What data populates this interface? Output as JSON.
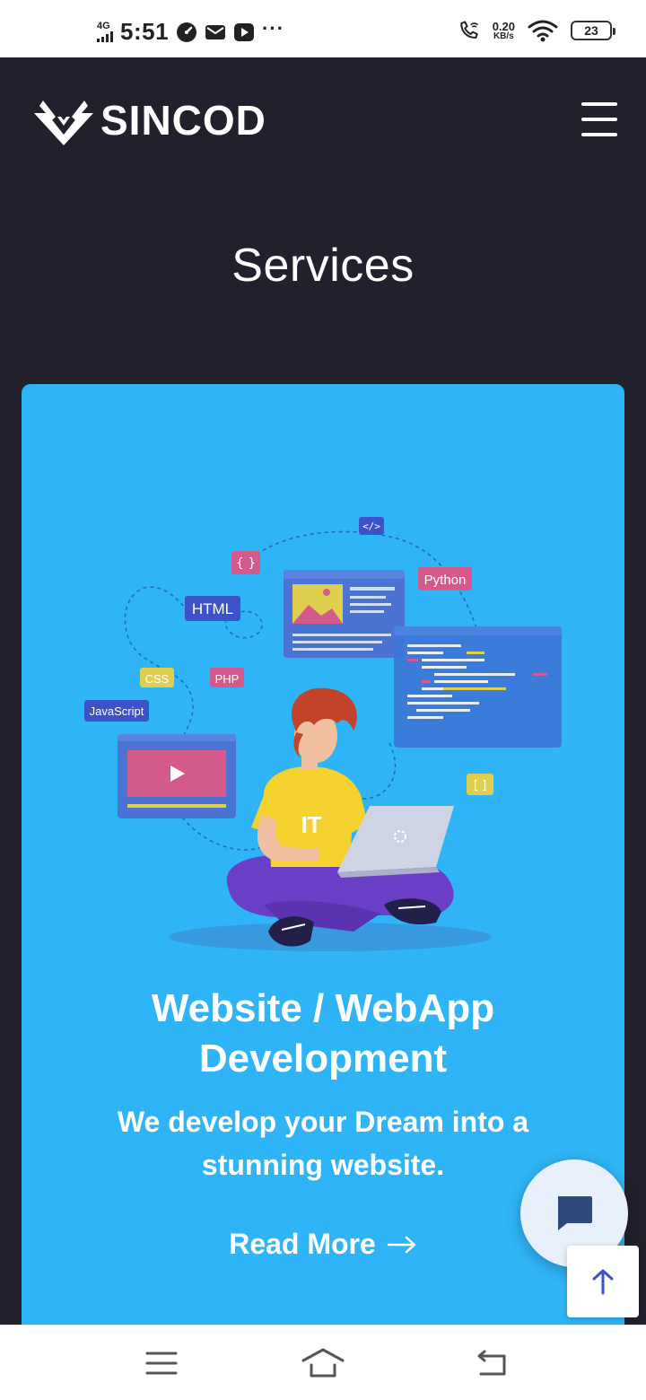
{
  "status_bar": {
    "network": "4G",
    "time": "5:51",
    "speed_value": "0.20",
    "speed_unit": "KB/s",
    "battery": "23",
    "icons": [
      "signal-icon",
      "speedometer-icon",
      "mail-icon",
      "youtube-icon",
      "more-dots-icon",
      "wifi-call-icon",
      "wifi-icon",
      "battery-icon"
    ]
  },
  "header": {
    "brand": "SINCOD",
    "menu_icon": "hamburger-menu-icon"
  },
  "section": {
    "title": "Services"
  },
  "card": {
    "title_line1": "Website / WebApp",
    "title_line2": "Development",
    "desc_line1": "We develop your Dream into a",
    "desc_line2": "stunning website.",
    "cta": "Read More",
    "bg_color": "#2fb4f7",
    "illustration_tags": {
      "code": "</>",
      "braces": "{ }",
      "python": "Python",
      "html": "HTML",
      "css": "CSS",
      "php": "PHP",
      "javascript": "JavaScript",
      "brackets": "[ ]",
      "shirt": "IT"
    }
  },
  "colors": {
    "page_bg": "#23202e",
    "accent_blue": "#2fb4f7",
    "fab_icon": "#2c4a7a"
  }
}
